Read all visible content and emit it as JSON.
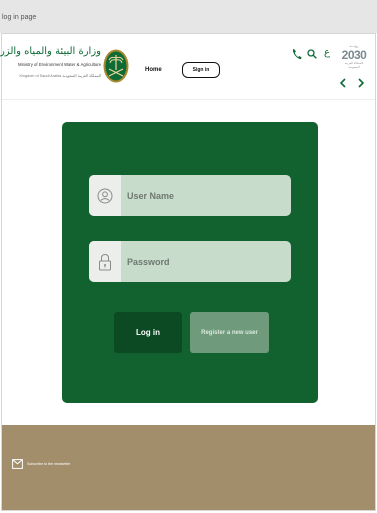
{
  "page": {
    "label": "log in page"
  },
  "header": {
    "ministry": {
      "arabic_name": "وزارة البيئة والمياه والزراعة",
      "english_name": "Ministry of Environment Water & Agriculture",
      "kingdom_en": "Kingdom of Saudi Arabia",
      "kingdom_ar": "المملكة العربية السعودية",
      "logo_icon": "palm-swords-emblem-icon"
    },
    "nav": {
      "home_label": "Home"
    },
    "signin_label": "Sign in",
    "language_toggle": "ع",
    "vision": {
      "top": "رؤيـــة",
      "year": "2030",
      "sub": "المملكة العربية السعودية"
    },
    "icons": {
      "phone": "phone-icon",
      "search": "search-icon",
      "prev": "chevron-left-icon",
      "next": "chevron-right-icon"
    }
  },
  "login": {
    "username_placeholder": "User Name",
    "password_placeholder": "Password",
    "login_button": "Log in",
    "register_button": "Register a new user"
  },
  "footer": {
    "subscribe_text": "Subscribe to the newsletter"
  },
  "colors": {
    "brand_green": "#11622f",
    "login_button": "#0c4a23",
    "register_button": "#6f9b7c",
    "field_bg": "#c8dccc",
    "footer": "#a28e6a"
  }
}
